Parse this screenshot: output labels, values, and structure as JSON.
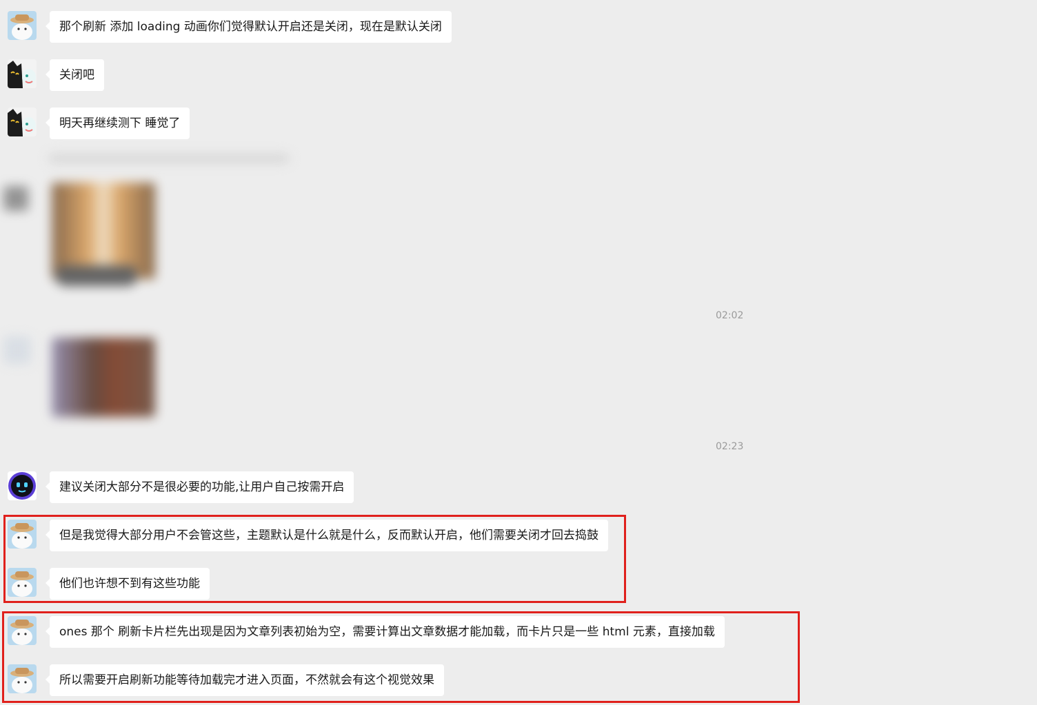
{
  "messages": [
    {
      "text": "那个刷新 添加 loading 动画你们觉得默认开启还是关闭，现在是默认关闭"
    },
    {
      "text": "关闭吧"
    },
    {
      "text": "明天再继续测下 睡觉了"
    },
    {
      "text": "建议关闭大部分不是很必要的功能,让用户自己按需开启"
    },
    {
      "text": "但是我觉得大部分用户不会管这些，主题默认是什么就是什么，反而默认开启，他们需要关闭才回去捣鼓"
    },
    {
      "text": "他们也许想不到有这些功能"
    },
    {
      "text": "ones 那个 刷新卡片栏先出现是因为文章列表初始为空，需要计算出文章数据才能加载，而卡片只是一些 html 元素，直接加载"
    },
    {
      "text": "所以需要开启刷新功能等待加载完才进入页面，不然就会有这个视觉效果"
    }
  ],
  "timestamps": [
    "02:02",
    "02:23"
  ],
  "colors": {
    "background": "#ededed",
    "bubble": "#ffffff",
    "highlight": "#e0201c",
    "timestamp": "#9a9a9a"
  },
  "avatars": [
    "straw-hat-cat-avatar",
    "black-cat-unicorn-avatar",
    "robot-face-avatar"
  ]
}
